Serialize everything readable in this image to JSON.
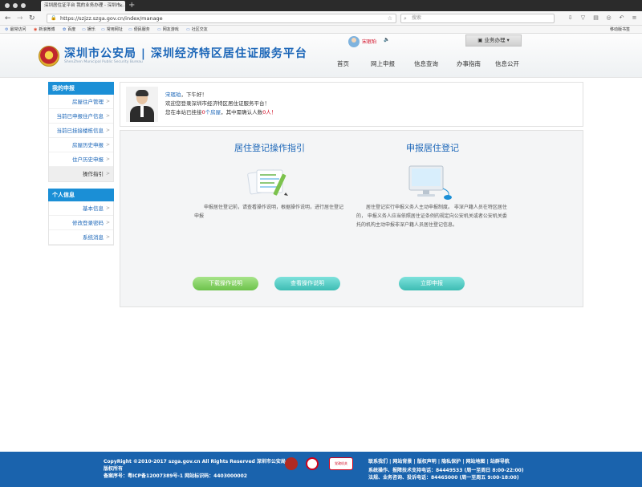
{
  "browser": {
    "tab_title": "深圳居住证平台 我的业务办理 - 深圳市...",
    "url": "https://szjzz.szga.gov.cn/index/manage",
    "search_placeholder": "搜索",
    "bookmarks": [
      "最常访问",
      "新浪微博",
      "百度",
      "娱乐",
      "常用网址",
      "便民服务",
      "网友游戏",
      "社区交友"
    ],
    "mobile_bookmarks": "移动版书签"
  },
  "header": {
    "logo_title": "深圳市公安局 | 深圳经济特区居住证服务平台",
    "logo_subtitle": "ShenZhen Municipal Public Security Bureau",
    "user_name": "宋珉珀",
    "business_button": "业务办理",
    "nav": [
      "首页",
      "网上申报",
      "信息查询",
      "办事指南",
      "信息公开"
    ]
  },
  "sidebar": {
    "section1_title": "我的申报",
    "section1_items": [
      "房屋住户管理",
      "当前已申报住户信息",
      "当前已挂接楼栋信息",
      "房屋历史申报",
      "住户历史申报",
      "操作指引"
    ],
    "section2_title": "个人信息",
    "section2_items": [
      "基本信息",
      "修改登录密码",
      "系统消息"
    ]
  },
  "welcome": {
    "name": "宋珉珀",
    "greeting_suffix": "，下午好！",
    "line2": "欢迎您登录深圳市经济特区居住证服务平台！",
    "line3_prefix": "您在本站已挂接",
    "house_count": "0",
    "house_unit": "个房屋",
    "line3_mid": "，其中需确认人数",
    "confirm_count": "0",
    "confirm_unit": "人！"
  },
  "guide": {
    "left_title": "居住登记操作指引",
    "left_desc": "申报居住登记前，请查看操作说明，根据操作说明，进行居住登记申报",
    "right_title": "申报居住登记",
    "right_desc": "居住登记实行申报义务人主动申报制度。 非深户籍人员在特区居住的， 申报义务人应当依照居住证条例的规定向公安机关或者公安机关委托的机构主动申报非深户籍人员居住登记信息。",
    "download_button": "下载操作说明",
    "view_button": "查看操作说明",
    "apply_button": "立即申报"
  },
  "footer": {
    "copyright": "CopyRight ©2010-2017 szga.gov.cn All Rights Reserved 深圳市公安局",
    "rights": "版权所有",
    "icp": "备案序号：粤ICP备12007389号-1 网站标识码：4403000002",
    "links": "联系我们 | 网站背景 | 版权声明 | 隐私保护 | 网站地图 | 站群导航",
    "support": "系统操作、报障技术支持电话：84449533 (周一至周日 8:00-22:00)",
    "consult": "法规、业务咨询、投诉电话：84465000 (周一至周五 9:00-18:00)",
    "badge3_text": "党政机关"
  },
  "colors": {
    "accent_blue": "#1b8fd6",
    "link_blue": "#1b66b8",
    "footer_blue": "#1a63ad",
    "alert_red": "#d0021b",
    "pill_green": "#6cc24a",
    "pill_teal": "#3cbcb3"
  }
}
